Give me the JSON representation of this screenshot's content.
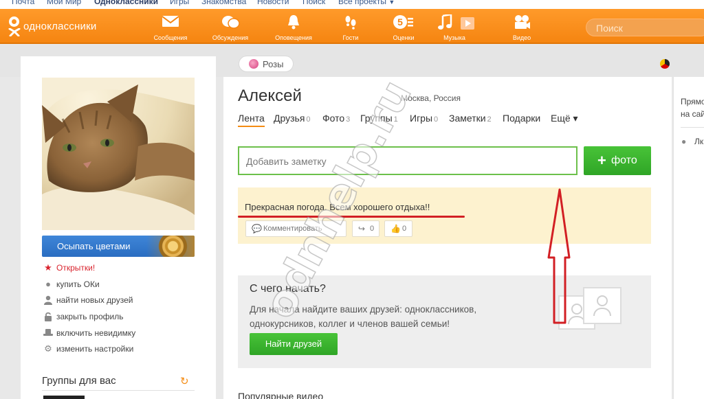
{
  "topbar": {
    "links": [
      "Почта",
      "Мой Мир",
      "Одноклассники",
      "Игры",
      "Знакомства",
      "Новости",
      "Поиск",
      "Все проекты"
    ]
  },
  "header": {
    "logo_text": "одноклассники",
    "nav": [
      {
        "label": "Сообщения",
        "icon": "envelope-icon"
      },
      {
        "label": "Обсуждения",
        "icon": "chat-bubbles-icon"
      },
      {
        "label": "Оповещения",
        "icon": "bell-icon"
      },
      {
        "label": "Гости",
        "icon": "footprints-icon"
      },
      {
        "label": "Оценки",
        "icon": "rating-5-icon"
      },
      {
        "label": "Музыка",
        "icon": "music-note-icon"
      },
      {
        "label": "Видео",
        "icon": "film-camera-icon"
      }
    ],
    "search_placeholder": "Поиск"
  },
  "strip": {
    "roses_label": "Розы"
  },
  "left": {
    "flowers_button": "Осыпать цветами",
    "menu": [
      {
        "label": "Открытки!",
        "icon": "star-icon"
      },
      {
        "label": "купить ОКи",
        "icon": "coin-icon"
      },
      {
        "label": "найти новых друзей",
        "icon": "person-icon"
      },
      {
        "label": "закрыть профиль",
        "icon": "lock-icon"
      },
      {
        "label": "включить невидимку",
        "icon": "hat-icon"
      },
      {
        "label": "изменить настройки",
        "icon": "gear-icon"
      }
    ],
    "groups_title": "Группы для вас"
  },
  "profile": {
    "name": "Алексей",
    "location": "Москва, Россия",
    "tabs": [
      {
        "label": "Лента",
        "count": ""
      },
      {
        "label": "Друзья",
        "count": "0"
      },
      {
        "label": "Фото",
        "count": "3"
      },
      {
        "label": "Группы",
        "count": "1"
      },
      {
        "label": "Игры",
        "count": "0"
      },
      {
        "label": "Заметки",
        "count": "2"
      },
      {
        "label": "Подарки",
        "count": ""
      },
      {
        "label": "Ещё ▾",
        "count": ""
      }
    ]
  },
  "composer": {
    "placeholder": "Добавить заметку",
    "photo_button": "фото"
  },
  "status": {
    "text": "Прекрасная погода. Всем хорошего отдыха!!",
    "comment_label": "Комментировать",
    "share_count": "0",
    "like_count": "0"
  },
  "start": {
    "title": "С чего начать?",
    "text": "Для начала найдите ваших друзей: одноклассников, однокурсников, коллег и членов вашей семьи!",
    "button": "Найти друзей"
  },
  "popular_title": "Популярные видео",
  "right": {
    "line1": "Прямо",
    "line2": "на сай",
    "line3": "Лк"
  },
  "watermark": "odnhelp.ru",
  "colors": {
    "header_orange": "#f58511",
    "accent_green": "#3cb52f",
    "status_bg": "#fdf2cf",
    "annotation_red": "#d21f24"
  }
}
